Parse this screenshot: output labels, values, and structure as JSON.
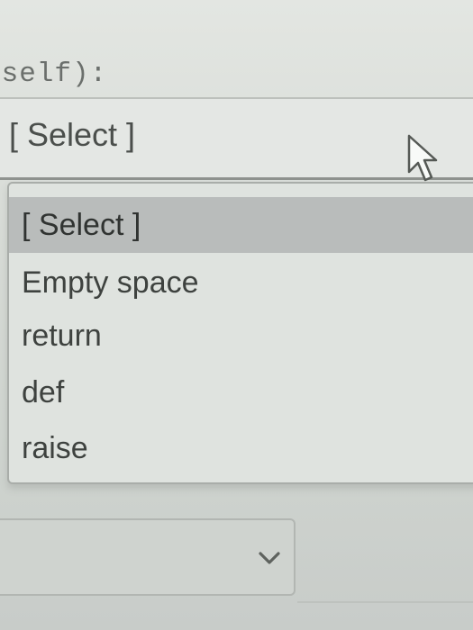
{
  "code_line": "(self):",
  "select": {
    "value": "[ Select ]"
  },
  "dropdown": {
    "items": [
      {
        "label": "[ Select ]",
        "selected": true
      },
      {
        "label": "Empty space",
        "selected": false
      },
      {
        "label": "return",
        "selected": false
      },
      {
        "label": "def",
        "selected": false
      },
      {
        "label": "raise",
        "selected": false
      }
    ]
  },
  "lower_select": {
    "value": ""
  },
  "icons": {
    "cursor": "arrow-cursor-icon",
    "chevron": "chevron-down-icon"
  },
  "colors": {
    "highlight": "#b9bcbb",
    "text": "#3e423f",
    "background": "#dfe3df"
  }
}
